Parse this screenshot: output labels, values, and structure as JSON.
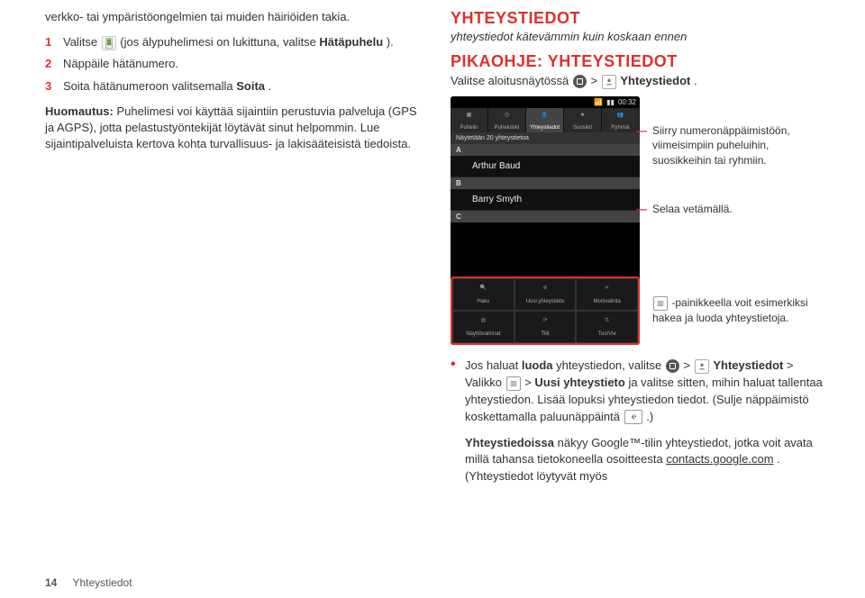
{
  "left": {
    "p1": "verkko- tai ympäristöongelmien tai muiden häiriöiden takia.",
    "steps": {
      "s1a": "Valitse ",
      "s1b": " (jos älypuhelimesi on lukittuna, valitse ",
      "s1c": "Hätäpuhelu",
      "s1d": ").",
      "s2": "Näppäile hätänumero.",
      "s3a": "Soita hätänumeroon valitsemalla ",
      "s3b": "Soita",
      "s3c": "."
    },
    "p2a": "Huomautus:",
    "p2b": " Puhelimesi voi käyttää sijaintiin perustuvia palveluja (GPS ja AGPS), jotta pelastustyöntekijät löytävät sinut helpommin. Lue sijaintipalveluista kertova kohta turvallisuus- ja lakisääteisistä tiedoista."
  },
  "right": {
    "h1": "YHTEYSTIEDOT",
    "sub1": "yhteystiedot kätevämmin kuin koskaan ennen",
    "h2": "PIKAOHJE: YHTEYSTIEDOT",
    "intro_a": "Valitse aloitusnäytössä ",
    "intro_b": " > ",
    "intro_c": " Yhteystiedot",
    "intro_d": ".",
    "phone": {
      "time": "00:32",
      "tabs": [
        "Puhelin",
        "Puheluloki",
        "Yhteystiedot",
        "Suosikit",
        "Ryhmät"
      ],
      "banner": "Näytetään 20 yhteystietoa",
      "secA": "A",
      "contactA": "Arthur Baud",
      "secB": "B",
      "contactB": "Barry Smyth",
      "secC": "C",
      "menu": [
        "Haku",
        "Uusi yhteystieto",
        "Monivalinta",
        "Näyttövalinnat",
        "Tilit",
        "Tuo/Vie"
      ]
    },
    "co1": "Siirry numeronäppäimistöön, viimeisimpiin puheluihin, suosikkeihin tai ryhmiin.",
    "co2": "Selaa vetämällä.",
    "co3": "-painikkeella voit esimerkiksi hakea ja luoda yhteystietoja.",
    "bul1_a": "Jos haluat ",
    "bul1_b": "luoda",
    "bul1_c": " yhteystiedon, valitse ",
    "bul1_d": " > ",
    "bul1_e": " Yhteystiedot",
    "bul1_f": " > Valikko ",
    "bul1_g": " > ",
    "bul1_h": "Uusi yhteystieto",
    "bul1_i": " ja valitse sitten, mihin haluat tallentaa yhteystiedon. Lisää lopuksi yhteystiedon tiedot. (Sulje näppäimistö koskettamalla paluunäppäintä ",
    "bul1_j": ".)",
    "bul2_a": "Yhteystiedoissa",
    "bul2_b": " näkyy Google™-tilin yhteystiedot, jotka voit avata millä tahansa tietokoneella osoitteesta ",
    "bul2_c": "contacts.google.com",
    "bul2_d": ". (Yhteystiedot löytyvät myös"
  },
  "footer": {
    "page": "14",
    "section": "Yhteystiedot"
  }
}
